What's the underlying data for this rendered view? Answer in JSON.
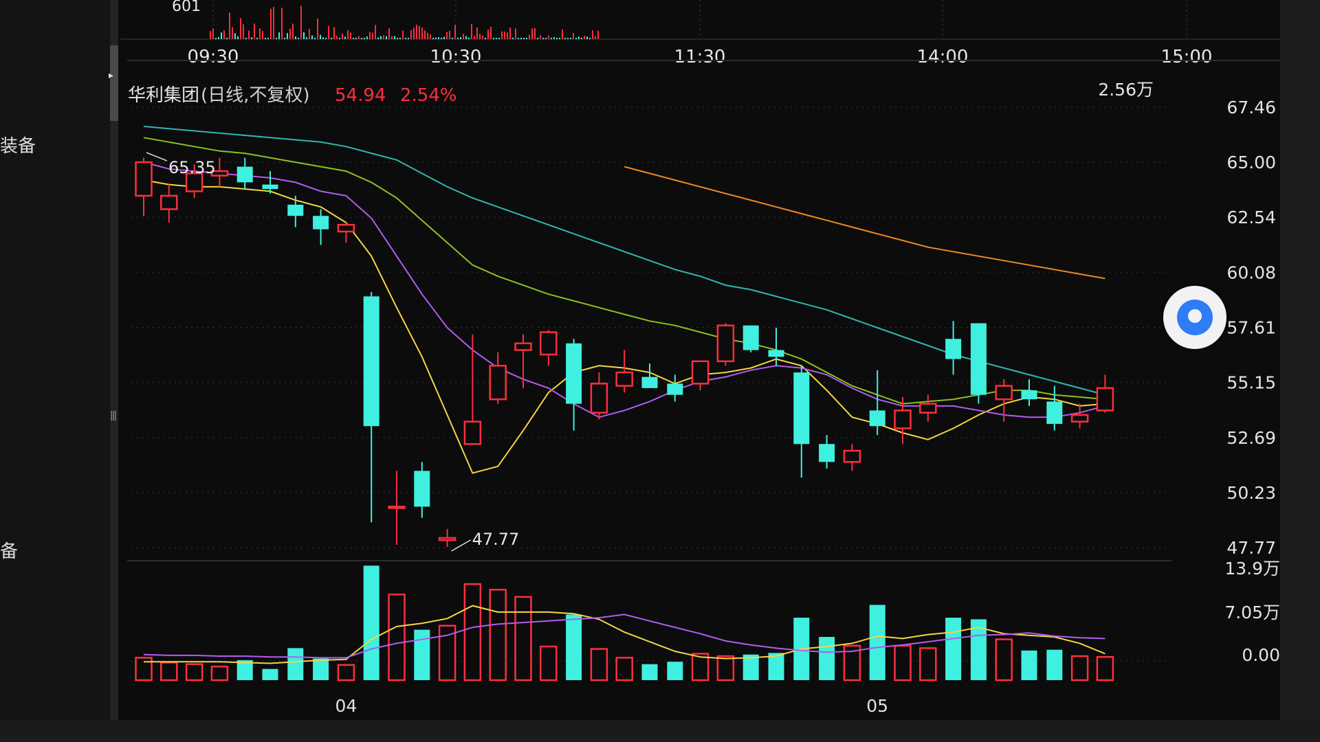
{
  "top_panel": {
    "volume_label": "601",
    "time_ticks": [
      "09:30",
      "10:30",
      "11:30",
      "14:00",
      "15:00"
    ]
  },
  "side_labels": [
    "装备",
    "备"
  ],
  "header": {
    "name": "华利集团",
    "period": "(日线,不复权)",
    "price": "54.94",
    "change": "2.54%",
    "volume": "2.56万"
  },
  "colors": {
    "up": "#ff2e3c",
    "down": "#3ff0e0",
    "ma5": "#f4d740",
    "ma10": "#b35cf0",
    "ma20": "#8dc21f",
    "ma30": "#2fb8b0",
    "ma60": "#f08a1e",
    "grid": "#3a3a3c"
  },
  "chart_data": {
    "type": "candlestick",
    "y_ticks": [
      "67.46",
      "65.00",
      "62.54",
      "60.08",
      "57.61",
      "55.15",
      "52.69",
      "50.23",
      "47.77"
    ],
    "ylim": [
      47.77,
      67.46
    ],
    "high_label": "65.35",
    "low_label": "47.77",
    "x_ticks": [
      {
        "label": "04",
        "index": 8
      },
      {
        "label": "05",
        "index": 29
      }
    ],
    "candles": [
      {
        "o": 63.5,
        "h": 65.2,
        "l": 62.6,
        "c": 65.0
      },
      {
        "o": 62.9,
        "h": 64.0,
        "l": 62.3,
        "c": 63.5
      },
      {
        "o": 63.7,
        "h": 64.9,
        "l": 63.4,
        "c": 64.5
      },
      {
        "o": 64.4,
        "h": 65.2,
        "l": 63.9,
        "c": 64.6
      },
      {
        "o": 64.8,
        "h": 65.2,
        "l": 63.8,
        "c": 64.1
      },
      {
        "o": 64.0,
        "h": 64.6,
        "l": 63.6,
        "c": 63.8
      },
      {
        "o": 63.1,
        "h": 63.5,
        "l": 62.1,
        "c": 62.6
      },
      {
        "o": 62.6,
        "h": 62.9,
        "l": 61.3,
        "c": 62.0
      },
      {
        "o": 61.9,
        "h": 62.3,
        "l": 61.4,
        "c": 62.2
      },
      {
        "o": 59.0,
        "h": 59.2,
        "l": 48.9,
        "c": 53.2
      },
      {
        "o": 49.6,
        "h": 51.2,
        "l": 47.9,
        "c": 49.6
      },
      {
        "o": 51.2,
        "h": 51.6,
        "l": 49.1,
        "c": 49.6
      },
      {
        "o": 48.1,
        "h": 48.6,
        "l": 47.8,
        "c": 48.2
      },
      {
        "o": 52.4,
        "h": 57.3,
        "l": 52.4,
        "c": 53.4
      },
      {
        "o": 54.4,
        "h": 56.5,
        "l": 54.2,
        "c": 55.9
      },
      {
        "o": 56.6,
        "h": 57.3,
        "l": 54.9,
        "c": 56.9
      },
      {
        "o": 56.4,
        "h": 57.5,
        "l": 55.9,
        "c": 57.4
      },
      {
        "o": 56.9,
        "h": 57.1,
        "l": 53.0,
        "c": 54.2
      },
      {
        "o": 53.8,
        "h": 55.6,
        "l": 53.5,
        "c": 55.1
      },
      {
        "o": 55.0,
        "h": 56.6,
        "l": 54.7,
        "c": 55.6
      },
      {
        "o": 55.4,
        "h": 56.0,
        "l": 54.9,
        "c": 54.9
      },
      {
        "o": 55.1,
        "h": 55.5,
        "l": 54.3,
        "c": 54.6
      },
      {
        "o": 55.1,
        "h": 56.1,
        "l": 54.8,
        "c": 56.1
      },
      {
        "o": 56.1,
        "h": 57.8,
        "l": 55.9,
        "c": 57.7
      },
      {
        "o": 57.7,
        "h": 57.7,
        "l": 56.5,
        "c": 56.6
      },
      {
        "o": 56.6,
        "h": 57.6,
        "l": 55.9,
        "c": 56.3
      },
      {
        "o": 55.6,
        "h": 55.9,
        "l": 50.9,
        "c": 52.4
      },
      {
        "o": 52.4,
        "h": 52.8,
        "l": 51.3,
        "c": 51.6
      },
      {
        "o": 51.6,
        "h": 52.4,
        "l": 51.2,
        "c": 52.1
      },
      {
        "o": 53.9,
        "h": 55.7,
        "l": 52.8,
        "c": 53.2
      },
      {
        "o": 53.1,
        "h": 54.5,
        "l": 52.4,
        "c": 53.9
      },
      {
        "o": 53.8,
        "h": 54.6,
        "l": 53.4,
        "c": 54.2
      },
      {
        "o": 57.1,
        "h": 57.9,
        "l": 55.5,
        "c": 56.2
      },
      {
        "o": 57.8,
        "h": 57.8,
        "l": 54.2,
        "c": 54.6
      },
      {
        "o": 54.4,
        "h": 55.3,
        "l": 53.4,
        "c": 55.0
      },
      {
        "o": 54.8,
        "h": 55.3,
        "l": 54.1,
        "c": 54.4
      },
      {
        "o": 54.3,
        "h": 55.0,
        "l": 53.0,
        "c": 53.3
      },
      {
        "o": 53.4,
        "h": 54.2,
        "l": 53.1,
        "c": 53.7
      },
      {
        "o": 53.9,
        "h": 55.5,
        "l": 53.8,
        "c": 54.9
      }
    ],
    "ma": [
      {
        "key": "ma5",
        "values": [
          64.2,
          64.0,
          63.9,
          63.9,
          63.8,
          63.7,
          63.3,
          63.0,
          62.3,
          60.8,
          58.5,
          56.3,
          53.7,
          51.1,
          51.4,
          53.0,
          54.7,
          55.6,
          55.9,
          55.8,
          55.6,
          55.1,
          55.5,
          55.6,
          55.8,
          56.2,
          55.9,
          54.8,
          53.6,
          53.3,
          52.9,
          52.6,
          53.1,
          53.7,
          54.2,
          54.5,
          54.4,
          54.1,
          54.2
        ]
      },
      {
        "key": "ma10",
        "values": [
          65.0,
          64.7,
          64.6,
          64.5,
          64.4,
          64.3,
          64.1,
          63.7,
          63.5,
          62.5,
          60.8,
          59.1,
          57.6,
          56.6,
          55.8,
          55.3,
          54.9,
          54.2,
          53.6,
          53.9,
          54.3,
          54.8,
          55.2,
          55.4,
          55.7,
          55.9,
          55.8,
          55.5,
          54.9,
          54.4,
          54.1,
          54.1,
          54.1,
          53.9,
          53.7,
          53.6,
          53.6,
          53.8,
          54.1
        ]
      },
      {
        "key": "ma20",
        "values": [
          66.1,
          65.9,
          65.7,
          65.5,
          65.4,
          65.2,
          65.0,
          64.8,
          64.6,
          64.1,
          63.4,
          62.4,
          61.4,
          60.4,
          59.9,
          59.5,
          59.1,
          58.8,
          58.5,
          58.2,
          57.9,
          57.7,
          57.4,
          57.1,
          56.9,
          56.6,
          56.2,
          55.6,
          55.0,
          54.6,
          54.2,
          54.3,
          54.4,
          54.6,
          54.8,
          54.8,
          54.6,
          54.5,
          54.4
        ]
      },
      {
        "key": "ma30",
        "values": [
          66.6,
          66.5,
          66.4,
          66.3,
          66.2,
          66.1,
          66.0,
          65.9,
          65.7,
          65.4,
          65.1,
          64.5,
          63.9,
          63.4,
          63.0,
          62.6,
          62.2,
          61.8,
          61.4,
          61.0,
          60.6,
          60.2,
          59.9,
          59.5,
          59.3,
          59.0,
          58.7,
          58.4,
          58.0,
          57.6,
          57.2,
          56.8,
          56.4,
          56.1,
          55.8,
          55.5,
          55.2,
          54.9,
          54.6
        ]
      },
      {
        "key": "ma60",
        "start": 19,
        "values": [
          64.8,
          64.5,
          64.2,
          63.9,
          63.6,
          63.3,
          63.0,
          62.7,
          62.4,
          62.1,
          61.8,
          61.5,
          61.2,
          61.0,
          60.8,
          60.6,
          60.4,
          60.2,
          60.0,
          59.8
        ]
      }
    ],
    "volume": {
      "y_ticks": [
        "13.9万",
        "7.05万",
        "0.00"
      ],
      "ylim": [
        0,
        13.9
      ],
      "unit": "万",
      "values": [
        2.8,
        2.2,
        2.0,
        1.7,
        2.5,
        1.4,
        4.0,
        2.7,
        1.9,
        14.3,
        10.7,
        6.3,
        6.8,
        12.0,
        11.3,
        10.4,
        4.2,
        8.2,
        3.9,
        2.8,
        2.0,
        2.3,
        3.3,
        3.0,
        3.2,
        3.4,
        7.8,
        5.4,
        4.3,
        9.4,
        4.3,
        4.0,
        7.8,
        7.6,
        5.1,
        3.7,
        3.8,
        3.0,
        2.9
      ],
      "ma": [
        {
          "key": "ma5",
          "values": [
            2.3,
            2.3,
            2.3,
            2.3,
            2.2,
            2.1,
            2.3,
            2.5,
            2.6,
            5.1,
            6.7,
            7.1,
            7.7,
            9.3,
            8.5,
            8.5,
            8.5,
            8.3,
            7.6,
            6.0,
            4.8,
            3.6,
            2.9,
            2.7,
            2.8,
            3.0,
            3.9,
            4.2,
            4.6,
            5.5,
            5.2,
            5.7,
            6.0,
            6.6,
            5.8,
            5.6,
            5.4,
            4.6,
            3.3
          ]
        },
        {
          "key": "ma10",
          "values": [
            3.2,
            3.1,
            3.1,
            3.0,
            3.0,
            2.9,
            2.9,
            2.8,
            2.8,
            3.9,
            4.6,
            5.1,
            5.6,
            6.6,
            7.0,
            7.2,
            7.4,
            7.6,
            7.8,
            8.2,
            7.4,
            6.6,
            5.8,
            4.9,
            4.4,
            4.0,
            3.7,
            3.5,
            3.6,
            4.1,
            4.4,
            4.8,
            5.2,
            5.6,
            5.7,
            5.9,
            5.5,
            5.3,
            5.2
          ]
        }
      ]
    }
  }
}
